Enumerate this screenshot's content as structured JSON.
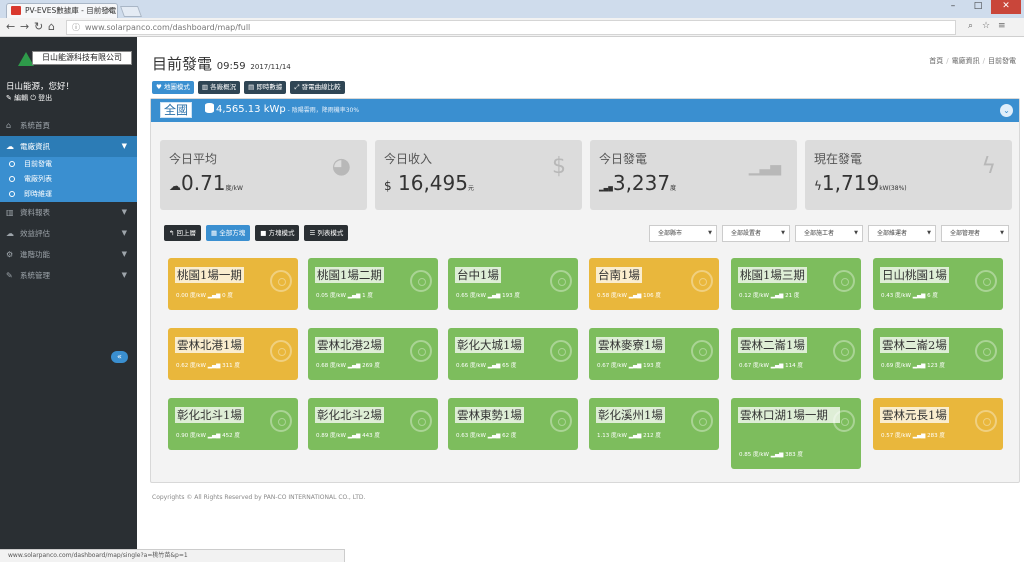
{
  "browser": {
    "tab_title": "PV-EVES數據庫 - 目前發電",
    "tab_close": "×",
    "url": "www.solarpanco.com/dashboard/map/full",
    "status_url": "www.solarpanco.com/dashboard/map/single?a=桃竹苗&p=1",
    "window_controls": {
      "minimize": "–",
      "maximize": "□",
      "close": "✕"
    }
  },
  "sidebar": {
    "logo_text": "日山能源科技有限公司",
    "greeting": "日山能源，您好！",
    "user_links": "✎ 編輯 ⏻ 登出",
    "menu": [
      {
        "label": "系統首頁",
        "icon": "home-icon",
        "glyph": "⌂"
      },
      {
        "label": "電廠資訊",
        "icon": "cloud-icon",
        "glyph": "☁"
      }
    ],
    "sub_menu": [
      "目前發電",
      "電廠列表",
      "即時維運"
    ],
    "menu_rest": [
      {
        "label": "資料報表",
        "icon": "chart-icon",
        "glyph": "▥"
      },
      {
        "label": "效益評估",
        "icon": "cloud-icon",
        "glyph": "☁"
      },
      {
        "label": "進階功能",
        "icon": "gear-icon",
        "glyph": "⚙"
      },
      {
        "label": "系統管理",
        "icon": "wrench-icon",
        "glyph": "✎"
      }
    ],
    "collapse_glyph": "«"
  },
  "header": {
    "title": "目前發電",
    "clock": "09:59",
    "date": "2017/11/14",
    "breadcrumb": [
      "首頁",
      "電廠資訊",
      "目前發電"
    ]
  },
  "view_tabs": [
    "♥ 地圖模式",
    "▥ 各廠概況",
    "▤ 即時數據",
    "⤢ 發電曲線比較"
  ],
  "panel": {
    "region": "全國",
    "capacity": "4,565.13 kWp",
    "note": " - 陰陽雲雨，降雨機率30%",
    "chevron": "⌄"
  },
  "stats": [
    {
      "title": "今日平均",
      "prefix": "☁",
      "value": "0.71",
      "unit": "度/kW",
      "icon": "speedometer-icon",
      "glyph": "◕"
    },
    {
      "title": "今日收入",
      "prefix": "$",
      "value": "16,495",
      "unit": "元",
      "icon": "dollar-icon",
      "glyph": "$"
    },
    {
      "title": "今日發電",
      "prefix": "▂▄▆",
      "value": "3,237",
      "unit": "度",
      "icon": "signal-icon",
      "glyph": "▁▃▅"
    },
    {
      "title": "現在發電",
      "prefix": "ϟ",
      "value": "1,719",
      "unit": "kW(38%)",
      "icon": "bolt-icon",
      "glyph": "ϟ"
    }
  ],
  "toolbar": [
    "↰ 回上層",
    "▦ 全部方塊",
    "■ 方塊模式",
    "☰ 列表模式"
  ],
  "filters": [
    "全部縣市",
    "全部設置者",
    "全部施工者",
    "全部維運者",
    "全部管理者"
  ],
  "filter_arrow": "▼",
  "stations": [
    {
      "name": "桃園1場一期",
      "info": "0.00 度/kW ▂▄▆ 0 度",
      "color": "yellow"
    },
    {
      "name": "桃園1場二期",
      "info": "0.05 度/kW ▂▄▆ 1 度",
      "color": "green"
    },
    {
      "name": "台中1場",
      "info": "0.65 度/kW ▂▄▆ 193 度",
      "color": "green"
    },
    {
      "name": "台南1場",
      "info": "0.58 度/kW ▂▄▆ 106 度",
      "color": "yellow"
    },
    {
      "name": "桃園1場三期",
      "info": "0.12 度/kW ▂▄▆ 21 度",
      "color": "green"
    },
    {
      "name": "日山桃園1場",
      "info": "0.43 度/kW ▂▄▆ 6 度",
      "color": "green"
    },
    {
      "name": "雲林北港1場",
      "info": "0.62 度/kW ▂▄▆ 311 度",
      "color": "yellow"
    },
    {
      "name": "雲林北港2場",
      "info": "0.68 度/kW ▂▄▆ 269 度",
      "color": "green"
    },
    {
      "name": "彰化大城1場",
      "info": "0.66 度/kW ▂▄▆ 65 度",
      "color": "green"
    },
    {
      "name": "雲林麥寮1場",
      "info": "0.67 度/kW ▂▄▆ 193 度",
      "color": "green"
    },
    {
      "name": "雲林二崙1場",
      "info": "0.67 度/kW ▂▄▆ 114 度",
      "color": "green"
    },
    {
      "name": "雲林二崙2場",
      "info": "0.69 度/kW ▂▄▆ 123 度",
      "color": "green"
    },
    {
      "name": "彰化北斗1場",
      "info": "0.90 度/kW ▂▄▆ 452 度",
      "color": "green"
    },
    {
      "name": "彰化北斗2場",
      "info": "0.89 度/kW ▂▄▆ 443 度",
      "color": "green"
    },
    {
      "name": "雲林東勢1場",
      "info": "0.63 度/kW ▂▄▆ 62 度",
      "color": "green"
    },
    {
      "name": "彰化溪州1場",
      "info": "1.13 度/kW ▂▄▆ 212 度",
      "color": "green"
    },
    {
      "name": "雲林口湖1場一期",
      "info": "0.85 度/kW ▂▄▆ 383 度",
      "color": "green"
    },
    {
      "name": "雲林元長1場",
      "info": "0.57 度/kW ▂▄▆ 283 度",
      "color": "yellow"
    }
  ],
  "footer": {
    "copyright": "Copyrights © All Rights Reserved by PAN-CO INTERNATIONAL CO., LTD."
  },
  "colors": {
    "accent": "#3a8fd0",
    "sidebar": "#2a2f33",
    "card_green": "#7dbd5d",
    "card_yellow": "#e9b73c"
  }
}
